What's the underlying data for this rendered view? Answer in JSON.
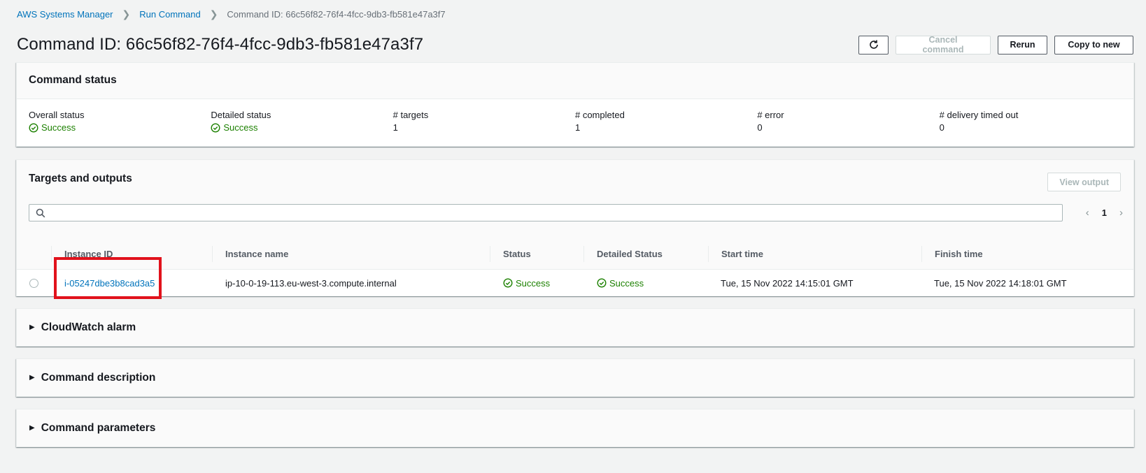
{
  "breadcrumb": {
    "items": [
      "AWS Systems Manager",
      "Run Command"
    ],
    "current": "Command ID: 66c56f82-76f4-4fcc-9db3-fb581e47a3f7"
  },
  "header": {
    "title": "Command ID: 66c56f82-76f4-4fcc-9db3-fb581e47a3f7",
    "buttons": {
      "refresh_icon": "refresh-icon",
      "cancel": "Cancel command",
      "rerun": "Rerun",
      "copy": "Copy to new"
    }
  },
  "command_status": {
    "title": "Command status",
    "fields": [
      {
        "label": "Overall status",
        "value": "Success",
        "status": true
      },
      {
        "label": "Detailed status",
        "value": "Success",
        "status": true
      },
      {
        "label": "# targets",
        "value": "1",
        "status": false
      },
      {
        "label": "# completed",
        "value": "1",
        "status": false
      },
      {
        "label": "# error",
        "value": "0",
        "status": false
      },
      {
        "label": "# delivery timed out",
        "value": "0",
        "status": false
      }
    ]
  },
  "targets": {
    "title": "Targets and outputs",
    "view_output": "View output",
    "search_placeholder": "",
    "page": "1",
    "columns": [
      "Instance ID",
      "Instance name",
      "Status",
      "Detailed Status",
      "Start time",
      "Finish time"
    ],
    "rows": [
      {
        "instance_id": "i-05247dbe3b8cad3a5",
        "instance_name": "ip-10-0-19-113.eu-west-3.compute.internal",
        "status": "Success",
        "detailed_status": "Success",
        "start_time": "Tue, 15 Nov 2022 14:15:01 GMT",
        "finish_time": "Tue, 15 Nov 2022 14:18:01 GMT"
      }
    ]
  },
  "sections": {
    "cloudwatch": "CloudWatch alarm",
    "description": "Command description",
    "parameters": "Command parameters"
  },
  "colors": {
    "link": "#0073bb",
    "success": "#1d8102",
    "highlight": "#e1121c"
  }
}
